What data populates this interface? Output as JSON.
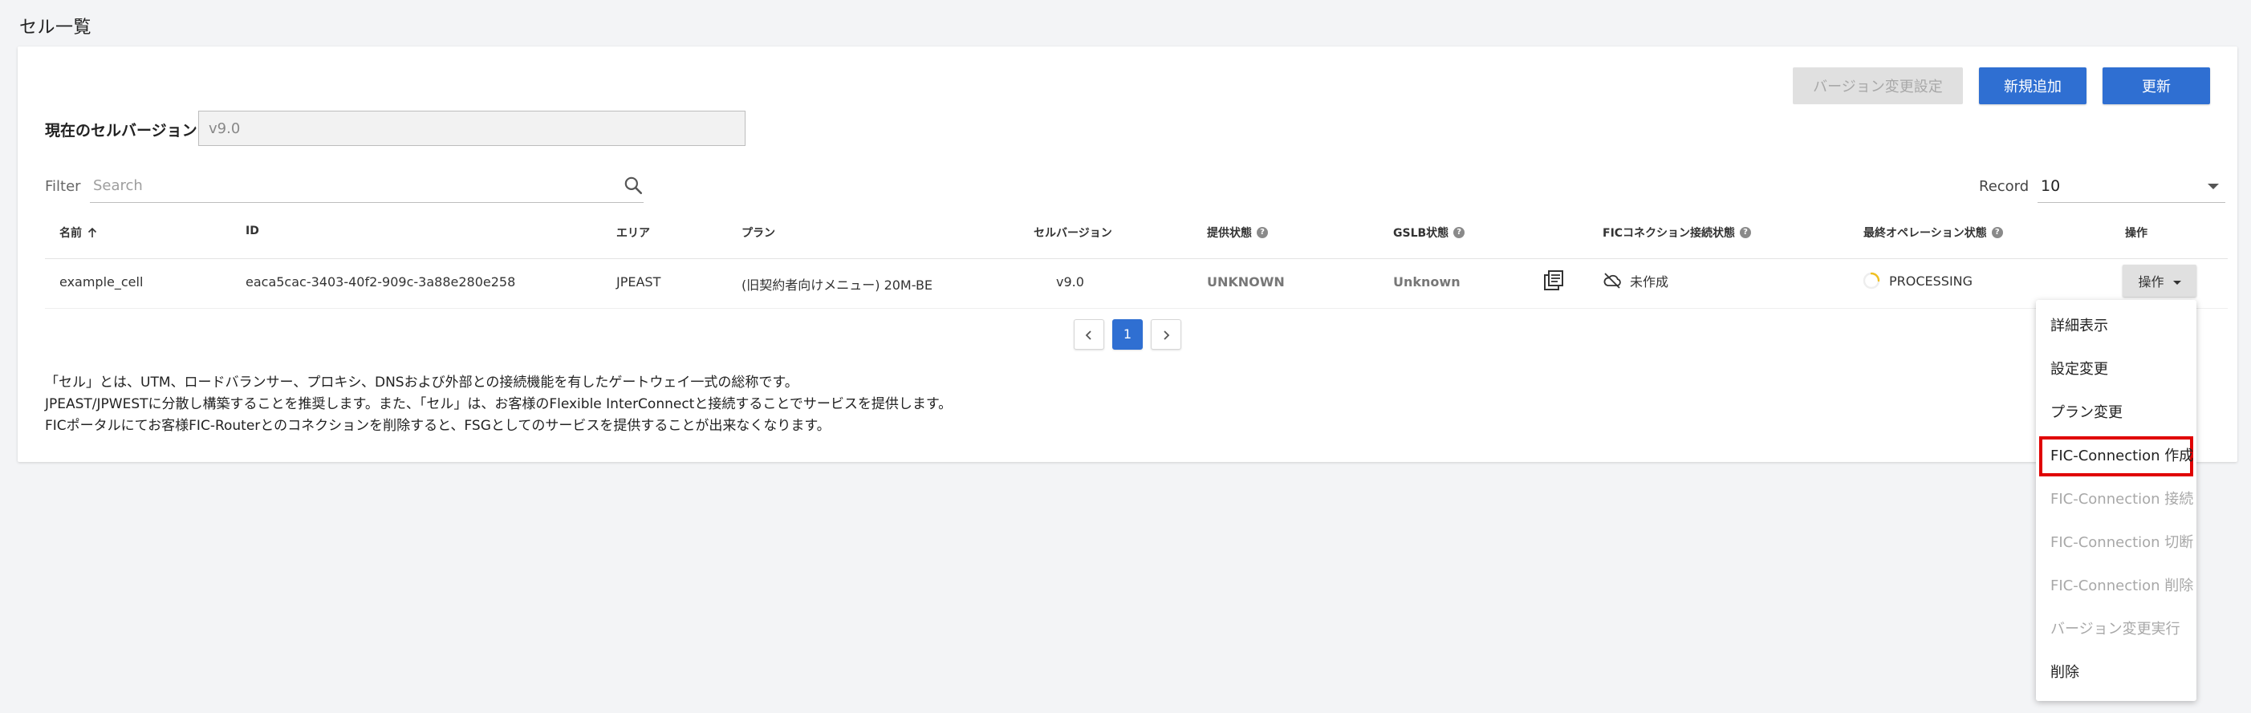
{
  "page": {
    "title": "セル一覧"
  },
  "toolbar": {
    "version_setting_label": "バージョン変更設定",
    "add_label": "新規追加",
    "refresh_label": "更新"
  },
  "version": {
    "label": "現在のセルバージョン",
    "value": "v9.0"
  },
  "filter": {
    "label": "Filter",
    "placeholder": "Search"
  },
  "record": {
    "label": "Record",
    "value": "10"
  },
  "table": {
    "headers": {
      "name": "名前",
      "id": "ID",
      "area": "エリア",
      "plan": "プラン",
      "cell_version": "セルバージョン",
      "provision_status": "提供状態",
      "gslb_status": "GSLB状態",
      "fic_status": "FICコネクション接続状態",
      "last_op_status": "最終オペレーション状態",
      "operation": "操作"
    },
    "rows": [
      {
        "name": "example_cell",
        "id": "eaca5cac-3403-40f2-909c-3a88e280e258",
        "area": "JPEAST",
        "plan": "(旧契約者向けメニュー) 20M-BE",
        "cell_version": "v9.0",
        "provision_status": "UNKNOWN",
        "gslb_status": "Unknown",
        "fic_status": "未作成",
        "last_op_status": "PROCESSING",
        "operation_label": "操作"
      }
    ]
  },
  "pagination": {
    "current": "1"
  },
  "description": {
    "line1": "「セル」とは、UTM、ロードバランサー、プロキシ、DNSおよび外部との接続機能を有したゲートウェイ一式の総称です。",
    "line2": "JPEAST/JPWESTに分散し構築することを推奨します。また、「セル」は、お客様のFlexible InterConnectと接続することでサービスを提供します。",
    "line3": "FICポータルにてお客様FIC-Routerとのコネクションを削除すると、FSGとしてのサービスを提供することが出来なくなります。"
  },
  "dropdown": {
    "items": [
      {
        "label": "詳細表示",
        "enabled": true
      },
      {
        "label": "設定変更",
        "enabled": true
      },
      {
        "label": "プラン変更",
        "enabled": true
      },
      {
        "label": "FIC-Connection 作成",
        "enabled": true,
        "highlighted": true
      },
      {
        "label": "FIC-Connection 接続",
        "enabled": false
      },
      {
        "label": "FIC-Connection 切断",
        "enabled": false
      },
      {
        "label": "FIC-Connection 削除",
        "enabled": false
      },
      {
        "label": "バージョン変更実行",
        "enabled": false
      },
      {
        "label": "削除",
        "enabled": true
      }
    ]
  },
  "colors": {
    "primary": "#2f6fd2",
    "highlight_border": "#e00000",
    "disabled_text": "#a8a8a8"
  }
}
